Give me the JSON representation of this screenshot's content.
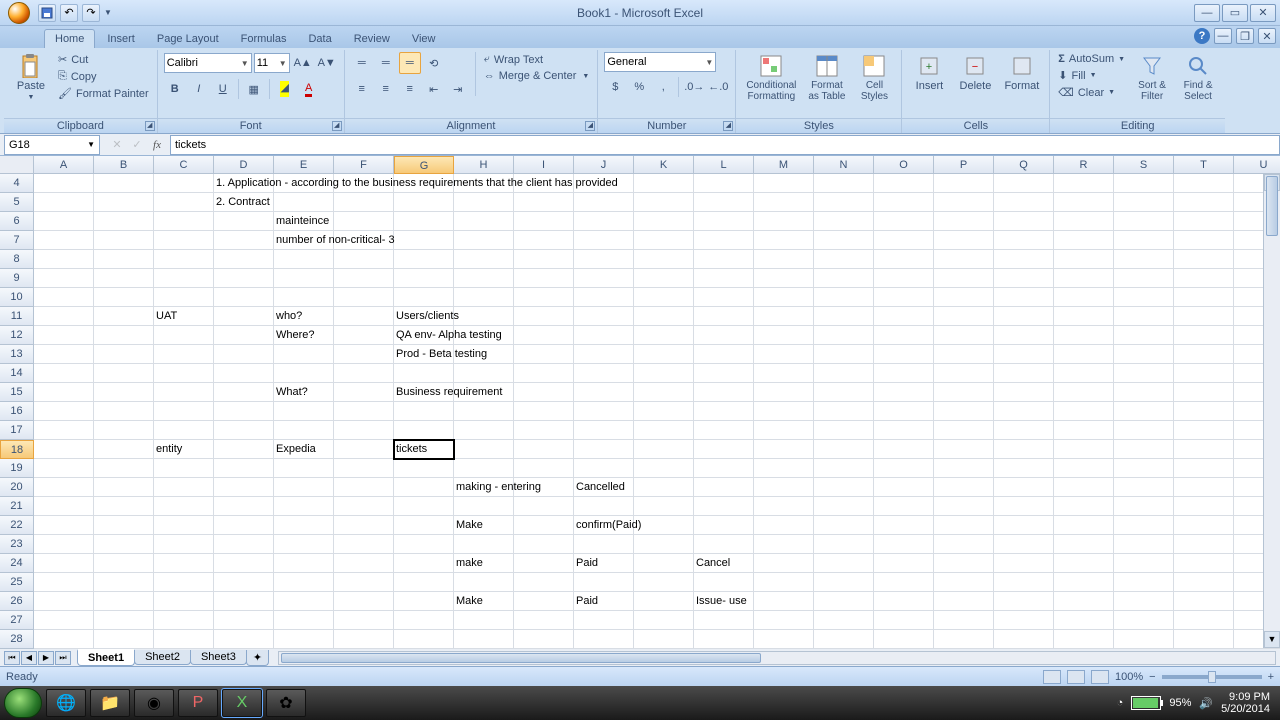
{
  "app": {
    "title": "Book1 - Microsoft Excel"
  },
  "qat": {
    "save": "save",
    "undo": "undo",
    "redo": "redo"
  },
  "tabs": [
    "Home",
    "Insert",
    "Page Layout",
    "Formulas",
    "Data",
    "Review",
    "View"
  ],
  "active_tab": 0,
  "clipboard": {
    "paste": "Paste",
    "cut": "Cut",
    "copy": "Copy",
    "format_painter": "Format Painter",
    "title": "Clipboard"
  },
  "font": {
    "name": "Calibri",
    "size": "11",
    "title": "Font",
    "bold": "B",
    "italic": "I",
    "underline": "U"
  },
  "alignment": {
    "wrap": "Wrap Text",
    "merge": "Merge & Center",
    "title": "Alignment"
  },
  "number": {
    "format": "General",
    "title": "Number"
  },
  "styles": {
    "cond": "Conditional\nFormatting",
    "fat": "Format\nas Table",
    "cell": "Cell\nStyles",
    "title": "Styles"
  },
  "cells_grp": {
    "insert": "Insert",
    "delete": "Delete",
    "format": "Format",
    "title": "Cells"
  },
  "editing": {
    "autosum": "AutoSum",
    "fill": "Fill",
    "clear": "Clear",
    "sort": "Sort &\nFilter",
    "find": "Find &\nSelect",
    "title": "Editing"
  },
  "namebox": "G18",
  "formula": "tickets",
  "columns": [
    "A",
    "B",
    "C",
    "D",
    "E",
    "F",
    "G",
    "H",
    "I",
    "J",
    "K",
    "L",
    "M",
    "N",
    "O",
    "P",
    "Q",
    "R",
    "S",
    "T",
    "U"
  ],
  "sel_col": 6,
  "row_start": 4,
  "row_count": 25,
  "sel_row": 18,
  "cells": {
    "4": {
      "D": "1. Application - according to the business requirements that the client has provided"
    },
    "5": {
      "D": "2. Contract"
    },
    "6": {
      "E": "mainteince"
    },
    "7": {
      "E": "number of non-critical- 3"
    },
    "11": {
      "C": "UAT",
      "E": "who?",
      "G": "Users/clients"
    },
    "12": {
      "E": "Where?",
      "G": "QA env- Alpha testing"
    },
    "13": {
      "G": "Prod - Beta testing"
    },
    "15": {
      "E": "What?",
      "G": "Business requirement"
    },
    "18": {
      "C": "entity",
      "E": "Expedia",
      "G": "tickets"
    },
    "20": {
      "H": "making - entering",
      "J": "Cancelled"
    },
    "22": {
      "H": "Make",
      "J": "confirm(Paid)"
    },
    "24": {
      "H": "make",
      "J": "Paid",
      "L": "Cancel"
    },
    "26": {
      "H": "Make",
      "J": "Paid",
      "L": "Issue- use"
    }
  },
  "sheets": [
    "Sheet1",
    "Sheet2",
    "Sheet3"
  ],
  "active_sheet": 0,
  "status": "Ready",
  "zoom": "100%",
  "tray": {
    "battery": "95%",
    "time": "9:09 PM",
    "date": "5/20/2014"
  }
}
